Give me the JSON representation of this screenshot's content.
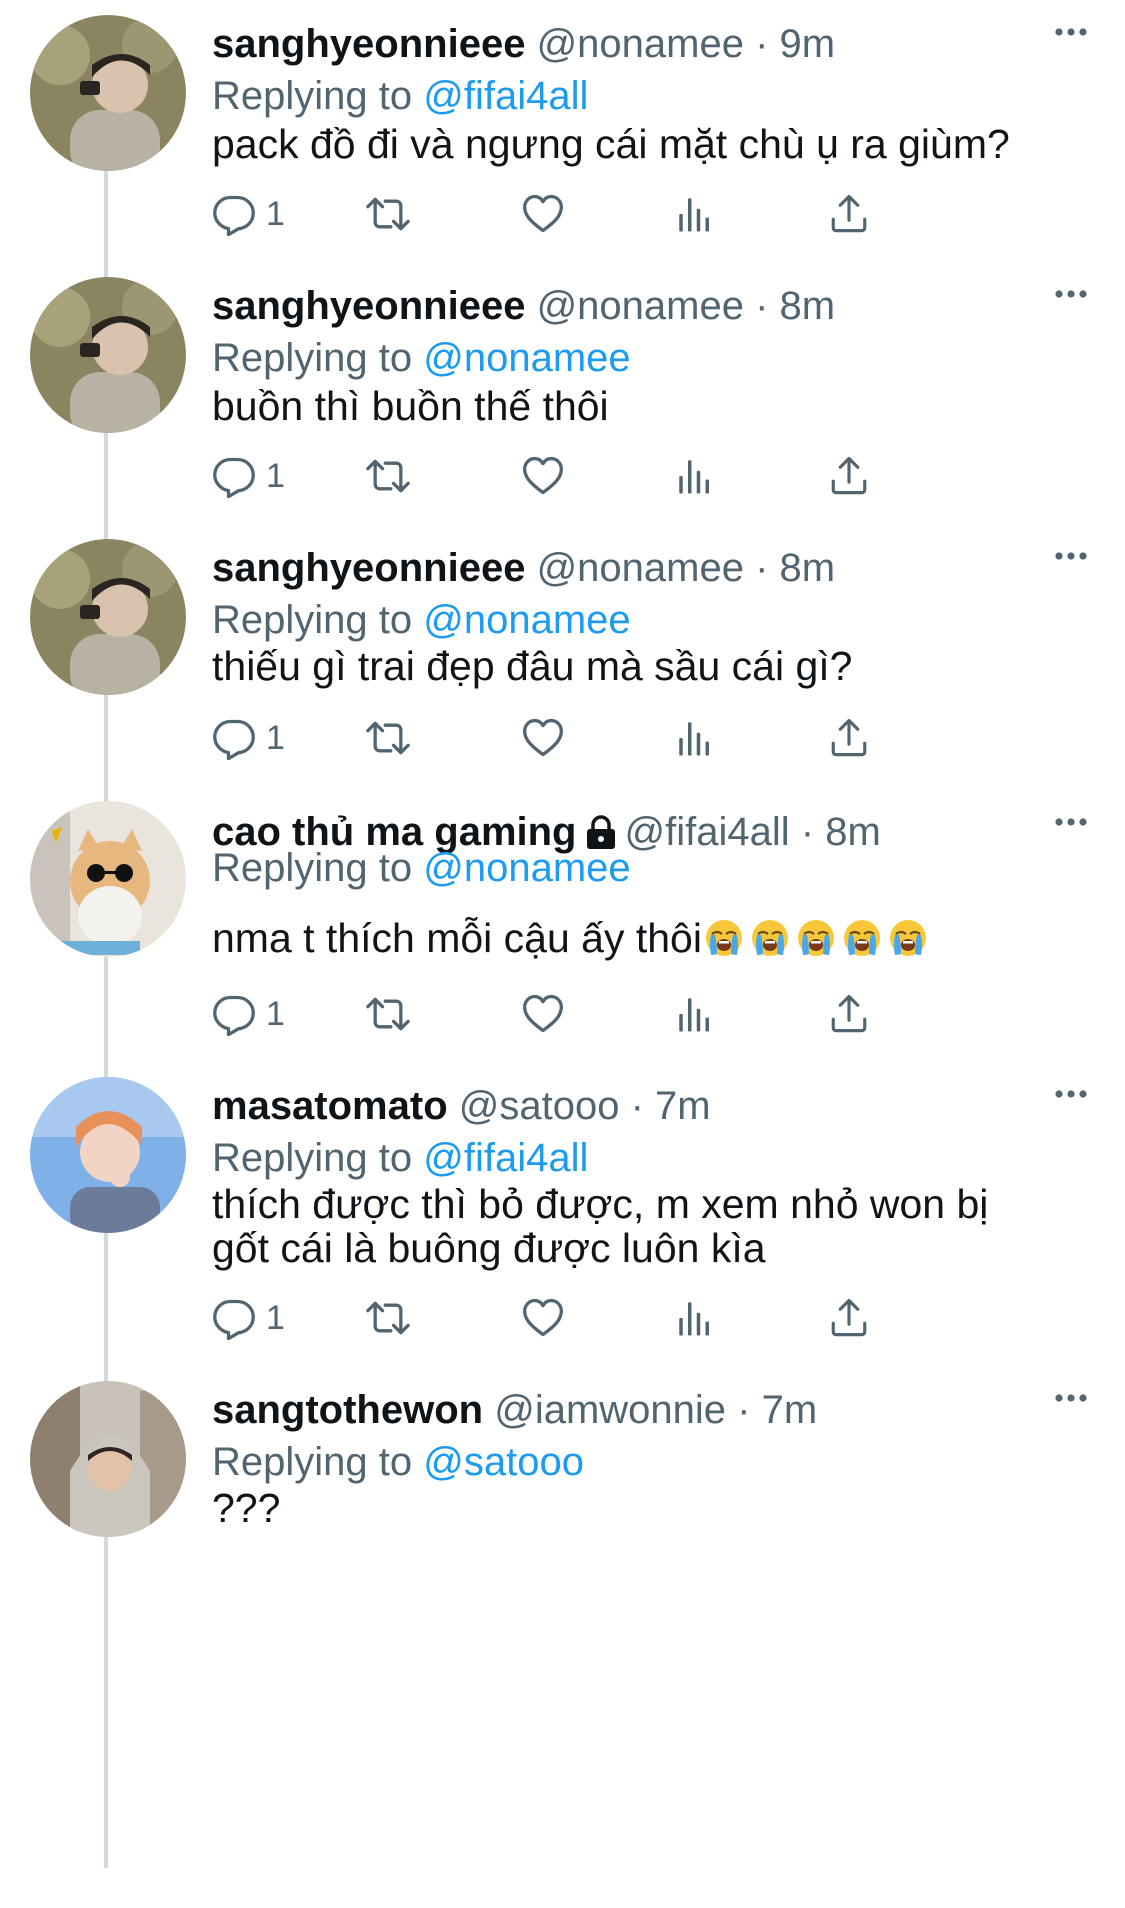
{
  "tweets": [
    {
      "name": "sanghyeonnieee",
      "handle": "@nonamee",
      "dot": "·",
      "time": "9m",
      "replying_prefix": "Replying to",
      "replying_to": "@fifai4all",
      "text": "pack đồ đi và ngưng cái mặt chù ụ ra giùm?",
      "reply_count": "1"
    },
    {
      "name": "sanghyeonnieee",
      "handle": "@nonamee",
      "dot": "·",
      "time": "8m",
      "replying_prefix": "Replying to",
      "replying_to": "@nonamee",
      "text": "buồn thì buồn thế thôi",
      "reply_count": "1"
    },
    {
      "name": "sanghyeonnieee",
      "handle": "@nonamee",
      "dot": "·",
      "time": "8m",
      "replying_prefix": "Replying to",
      "replying_to": "@nonamee",
      "text": "thiếu gì trai đẹp đâu mà sầu cái gì?",
      "reply_count": "1"
    },
    {
      "name": "cao thủ ma gaming",
      "handle": "@fifai4all",
      "dot": "·",
      "time": "8m",
      "replying_prefix": "Replying to",
      "replying_to": "@nonamee",
      "text": "nma t thích mỗi cậu ấy thôi",
      "emoji": "loudly-crying-face x5",
      "reply_count": "1",
      "protected_icon": "lock-icon"
    },
    {
      "name": "masatomato",
      "handle": "@satooo",
      "dot": "·",
      "time": "7m",
      "replying_prefix": "Replying to",
      "replying_to": "@fifai4all",
      "text_line1": "thích được thì bỏ được, m xem nhỏ won bị",
      "text_line2": "gốt cái là buông được luôn kìa",
      "reply_count": "1"
    },
    {
      "name": "sangtothewon",
      "handle": "@iamwonnie",
      "dot": "·",
      "time": "7m",
      "replying_prefix": "Replying to",
      "replying_to": "@satooo",
      "text": "???"
    }
  ],
  "icons": {
    "reply": "reply-icon",
    "retweet": "retweet-icon",
    "like": "heart-icon",
    "views": "views-icon",
    "share": "share-icon",
    "more": "more-icon"
  },
  "colors": {
    "link": "#1d9bf0",
    "secondary_text": "#536471",
    "thread_line": "#cfd9de"
  }
}
